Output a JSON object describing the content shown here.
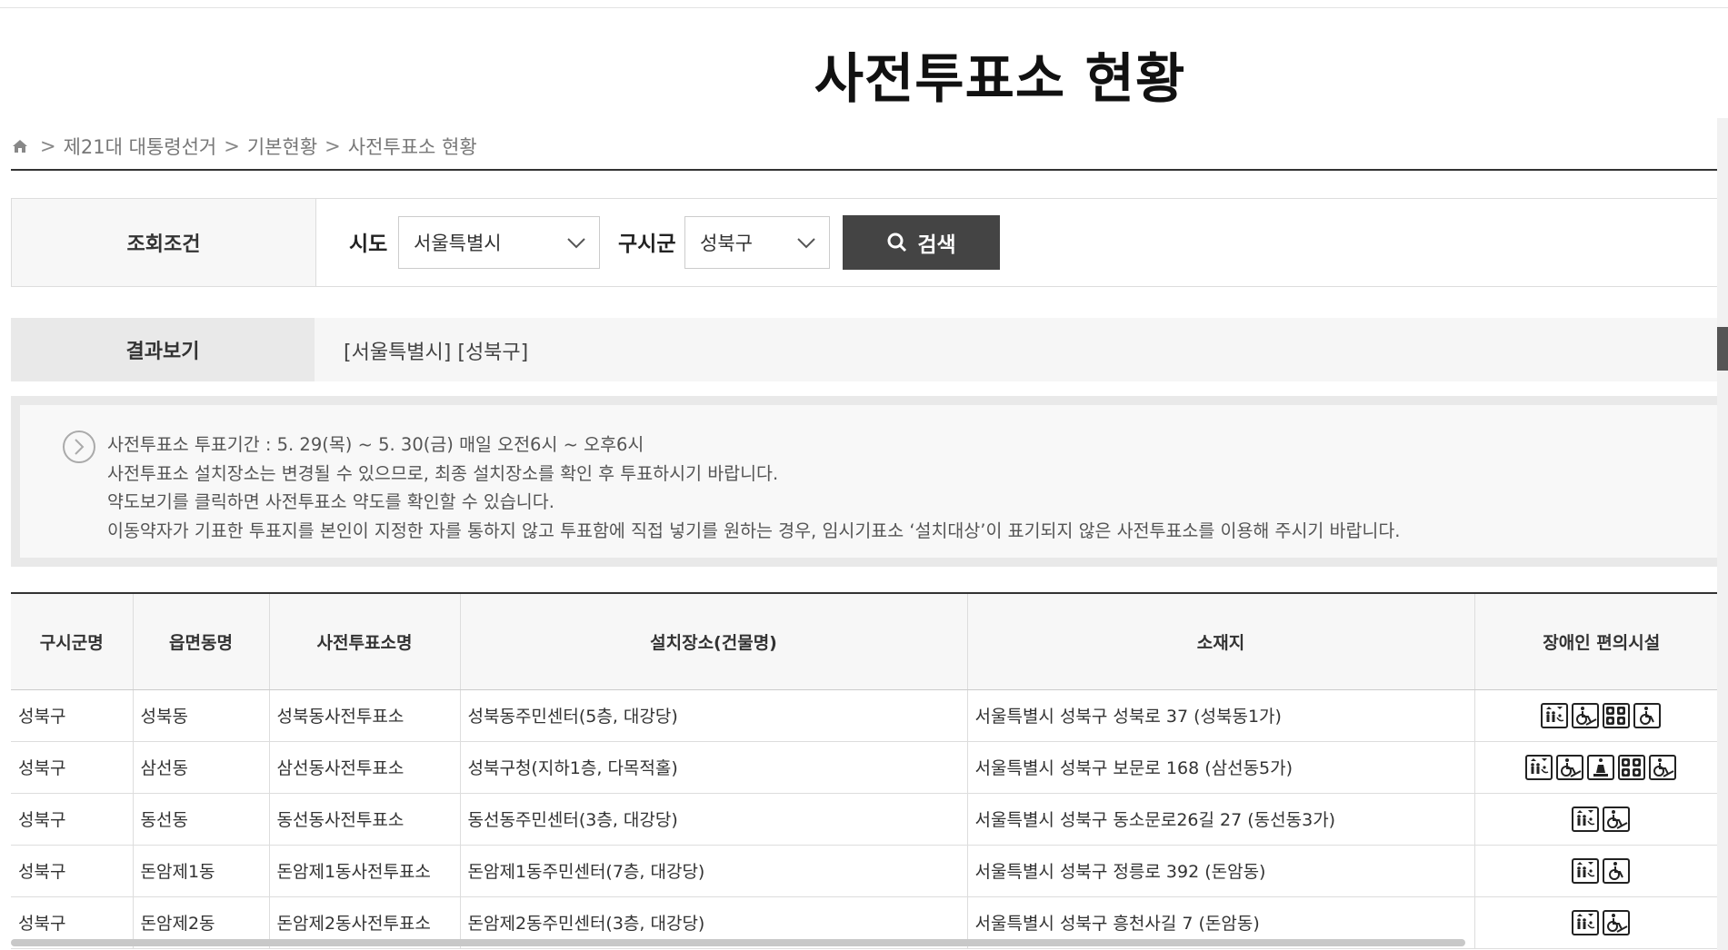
{
  "page": {
    "title": "사전투표소 현황"
  },
  "breadcrumb": {
    "sep": ">",
    "items": [
      "제21대 대통령선거",
      "기본현황",
      "사전투표소 현황"
    ]
  },
  "search": {
    "condition_label": "조회조건",
    "sido_label": "시도",
    "sido_value": "서울특별시",
    "gusigun_label": "구시군",
    "gusigun_value": "성북구",
    "button_label": "검색"
  },
  "result": {
    "label": "결과보기",
    "value": "[서울특별시] [성북구]"
  },
  "notice": {
    "lines": [
      "사전투표소 투표기간 : 5. 29(목) ~ 5. 30(금) 매일 오전6시 ~ 오후6시",
      "사전투표소 설치장소는 변경될 수 있으므로, 최종 설치장소를 확인 후 투표하시기 바랍니다.",
      "약도보기를 클릭하면 사전투표소 약도를 확인할 수 있습니다.",
      "이동약자가 기표한 투표지를 본인이 지정한 자를 통하지 않고 투표함에 직접 넣기를 원하는 경우, 임시기표소 ‘설치대상’이 표기되지 않은 사전투표소를 이용해 주시기 바랍니다."
    ]
  },
  "table": {
    "headers": [
      "구시군명",
      "읍면동명",
      "사전투표소명",
      "설치장소(건물명)",
      "소재지",
      "장애인 편의시설"
    ],
    "rows": [
      {
        "gu": "성북구",
        "dong": "성북동",
        "name": "성북동사전투표소",
        "place": "성북동주민센터(5층, 대강당)",
        "address": "서울특별시 성북구 성북로 37 (성북동1가)",
        "facilities": [
          "elevator-icon",
          "wheelchair-ramp-icon",
          "braille-icon",
          "wheelchair-icon"
        ]
      },
      {
        "gu": "성북구",
        "dong": "삼선동",
        "name": "삼선동사전투표소",
        "place": "성북구청(지하1층, 다목적홀)",
        "address": "서울특별시 성북구 보문로 168 (삼선동5가)",
        "facilities": [
          "elevator-icon",
          "wheelchair-ramp-icon",
          "bell-icon",
          "braille-icon",
          "wheelchair-ramp-icon"
        ]
      },
      {
        "gu": "성북구",
        "dong": "동선동",
        "name": "동선동사전투표소",
        "place": "동선동주민센터(3층, 대강당)",
        "address": "서울특별시 성북구 동소문로26길 27 (동선동3가)",
        "facilities": [
          "elevator-icon",
          "wheelchair-ramp-icon"
        ]
      },
      {
        "gu": "성북구",
        "dong": "돈암제1동",
        "name": "돈암제1동사전투표소",
        "place": "돈암제1동주민센터(7층, 대강당)",
        "address": "서울특별시 성북구 정릉로 392 (돈암동)",
        "facilities": [
          "elevator-icon",
          "wheelchair-icon"
        ]
      },
      {
        "gu": "성북구",
        "dong": "돈암제2동",
        "name": "돈암제2동사전투표소",
        "place": "돈암제2동주민센터(3층, 대강당)",
        "address": "서울특별시 성북구 흥천사길 7 (돈암동)",
        "facilities": [
          "elevator-icon",
          "wheelchair-ramp-icon"
        ]
      }
    ]
  }
}
